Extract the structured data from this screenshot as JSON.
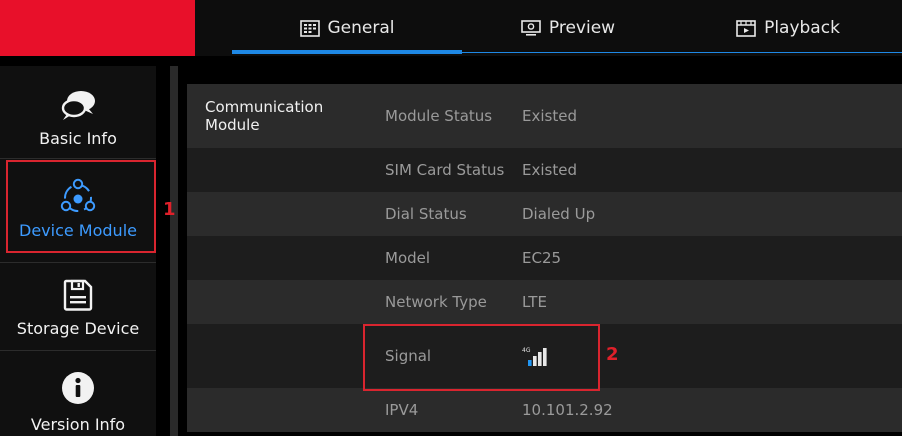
{
  "tabs": [
    {
      "label": "General",
      "icon": "general-grid-icon"
    },
    {
      "label": "Preview",
      "icon": "monitor-icon"
    },
    {
      "label": "Playback",
      "icon": "playback-icon"
    }
  ],
  "sidebar": {
    "items": [
      {
        "label": "Basic Info",
        "icon": "chat-bubbles-icon"
      },
      {
        "label": "Device Module",
        "icon": "module-network-icon"
      },
      {
        "label": "Storage Device",
        "icon": "floppy-disk-icon"
      },
      {
        "label": "Version Info",
        "icon": "info-icon"
      }
    ]
  },
  "table": {
    "category": "Communication Module",
    "rows": [
      {
        "key": "Module Status",
        "value": "Existed"
      },
      {
        "key": "SIM Card Status",
        "value": "Existed"
      },
      {
        "key": "Dial Status",
        "value": "Dialed Up"
      },
      {
        "key": "Model",
        "value": "EC25"
      },
      {
        "key": "Network Type",
        "value": "LTE"
      },
      {
        "key": "Signal",
        "value": "",
        "signal_badge": "4G",
        "signal_bars": 4
      },
      {
        "key": "IPV4",
        "value": "10.101.2.92"
      }
    ]
  },
  "callouts": [
    "1",
    "2"
  ],
  "colors": {
    "accent": "#1e88e5",
    "brand": "#e8102a",
    "highlight": "#d9252f",
    "active": "#3d9bff"
  }
}
